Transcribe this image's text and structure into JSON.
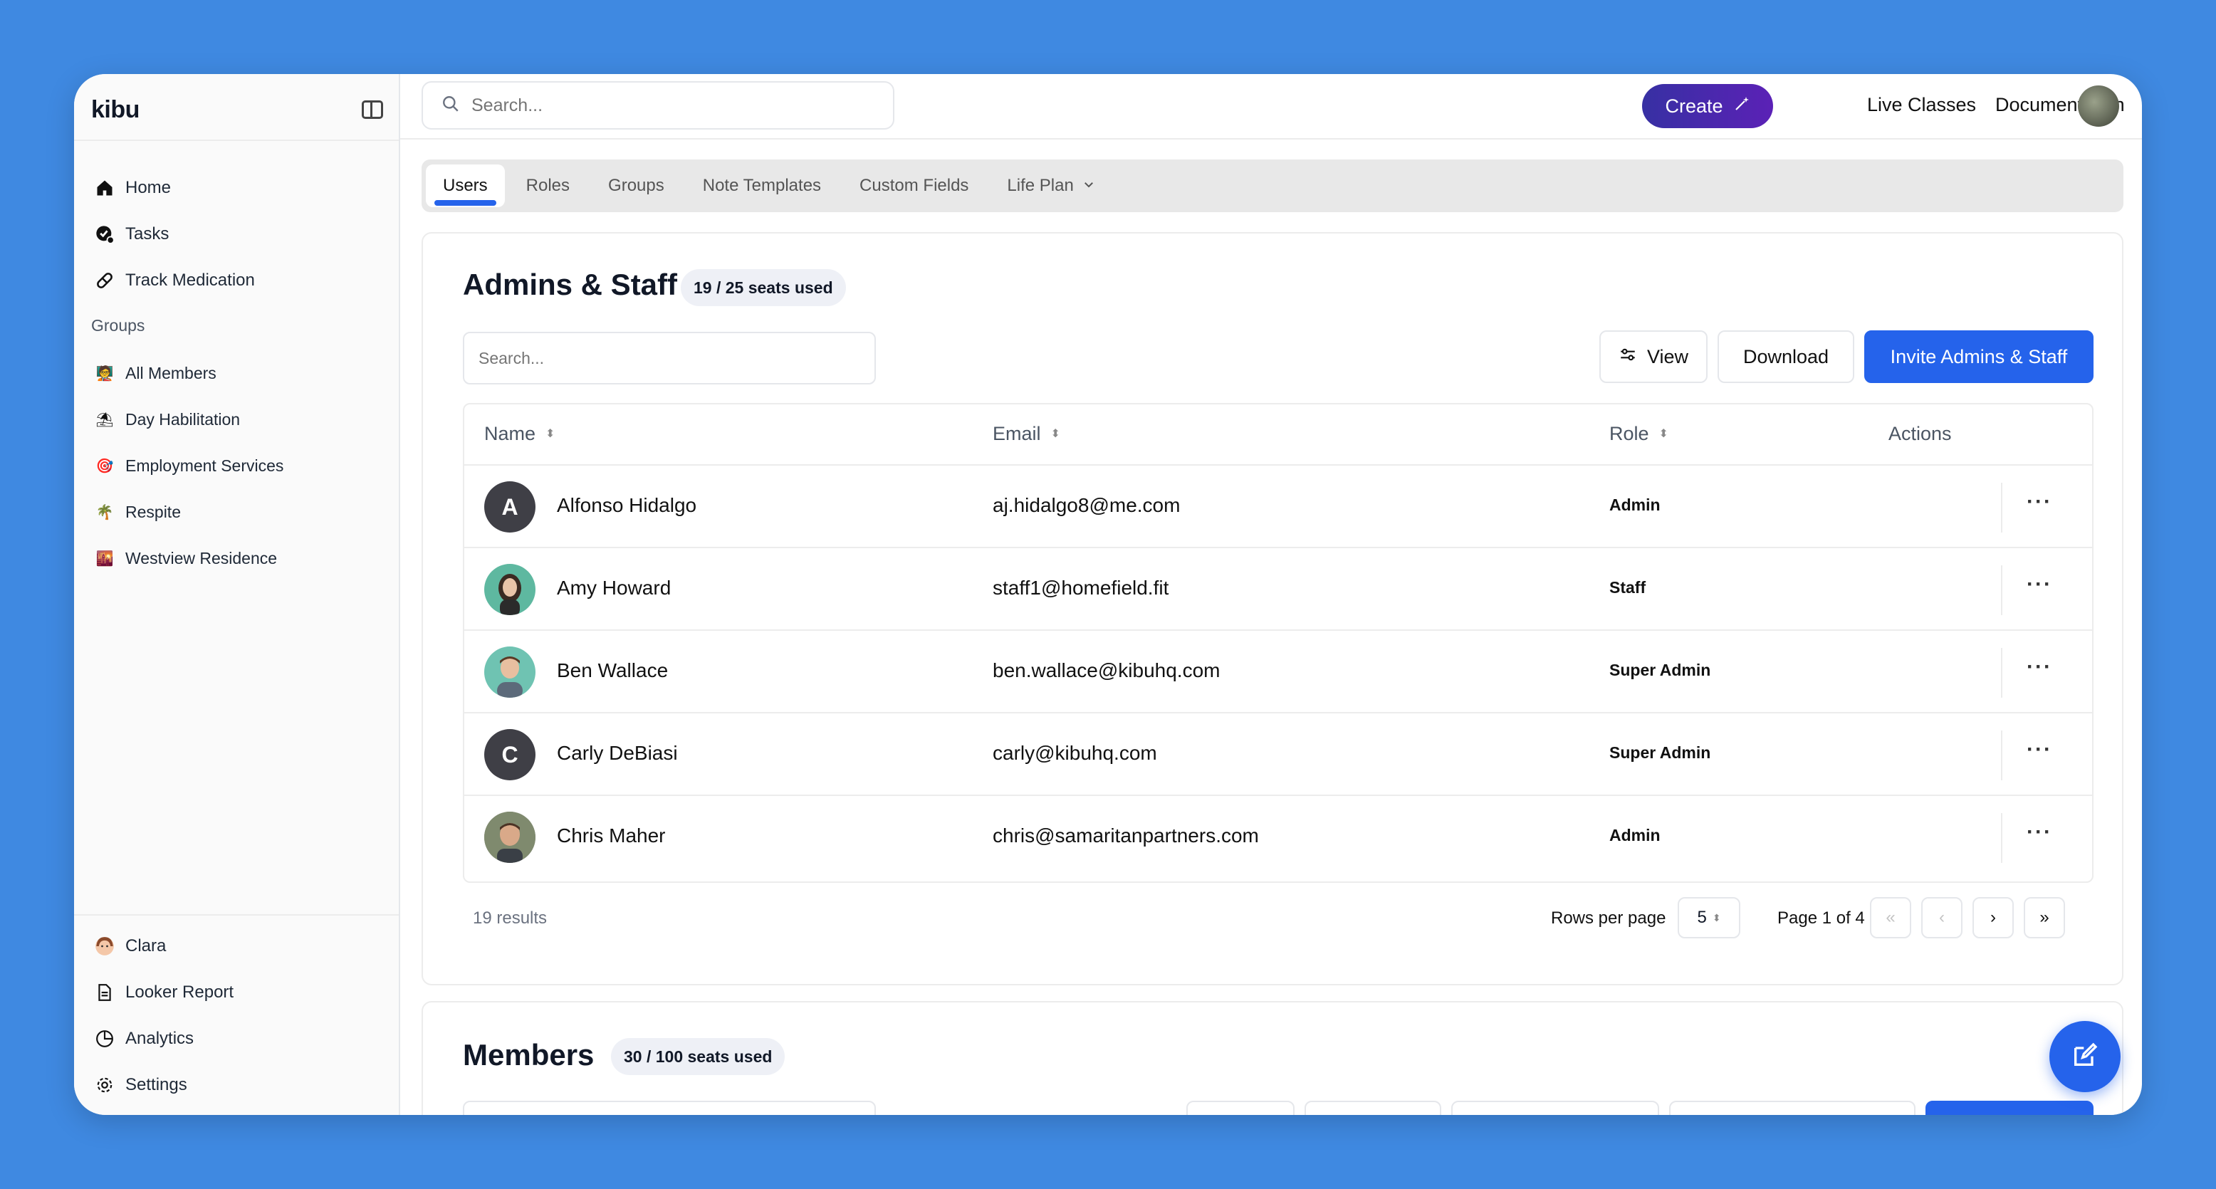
{
  "app": {
    "logo": "kibu",
    "search_placeholder": "Search...",
    "create_label": "Create",
    "live_classes": "Live Classes",
    "documentation": "Documentation"
  },
  "sidebar": {
    "top_items": [
      {
        "label": "Home",
        "icon": "home-icon"
      },
      {
        "label": "Tasks",
        "icon": "tasks-icon"
      },
      {
        "label": "Track Medication",
        "icon": "pill-icon"
      }
    ],
    "groups_heading": "Groups",
    "groups": [
      {
        "label": "All Members",
        "icon": "members-emoji",
        "glyph": "🧑‍🏫"
      },
      {
        "label": "Day Habilitation",
        "icon": "beach-emoji",
        "glyph": "⛱"
      },
      {
        "label": "Employment Services",
        "icon": "target-emoji",
        "glyph": "🎯"
      },
      {
        "label": "Respite",
        "icon": "palm-emoji",
        "glyph": "🌴"
      },
      {
        "label": "Westview Residence",
        "icon": "sunset-emoji",
        "glyph": "🌇"
      }
    ],
    "bottom_items": [
      {
        "label": "Clara",
        "icon": "clara-avatar-icon"
      },
      {
        "label": "Looker Report",
        "icon": "document-icon"
      },
      {
        "label": "Analytics",
        "icon": "pie-chart-icon"
      },
      {
        "label": "Settings",
        "icon": "gear-icon"
      }
    ]
  },
  "tabs": [
    "Users",
    "Roles",
    "Groups",
    "Note Templates",
    "Custom Fields",
    "Life Plan"
  ],
  "admins": {
    "title": "Admins & Staff",
    "seats": "19 / 25 seats used",
    "search_placeholder": "Search...",
    "view_label": "View",
    "download_label": "Download",
    "invite_label": "Invite Admins & Staff",
    "columns": {
      "name": "Name",
      "email": "Email",
      "role": "Role",
      "actions": "Actions"
    },
    "rows": [
      {
        "initial": "A",
        "name": "Alfonso Hidalgo",
        "email": "aj.hidalgo8@me.com",
        "role": "Admin",
        "avatar_color": "#3f3f46"
      },
      {
        "initial": "",
        "name": "Amy Howard",
        "email": "staff1@homefield.fit",
        "role": "Staff",
        "avatar_color": "#5eb8a0"
      },
      {
        "initial": "",
        "name": "Ben Wallace",
        "email": "ben.wallace@kibuhq.com",
        "role": "Super Admin",
        "avatar_color": "#6fc3b2"
      },
      {
        "initial": "C",
        "name": "Carly DeBiasi",
        "email": "carly@kibuhq.com",
        "role": "Super Admin",
        "avatar_color": "#3f3f46"
      },
      {
        "initial": "",
        "name": "Chris Maher",
        "email": "chris@samaritanpartners.com",
        "role": "Admin",
        "avatar_color": "#8a8f80"
      }
    ],
    "results": "19 results",
    "rows_per_page_label": "Rows per page",
    "rows_per_page_value": "5",
    "page_info": "Page 1 of 4"
  },
  "members": {
    "title": "Members",
    "seats": "30 / 100 seats used"
  },
  "colors": {
    "background": "#3f89e1",
    "primary": "#2563eb",
    "create_gradient_start": "#3730a3",
    "create_gradient_end": "#5b21b6"
  }
}
